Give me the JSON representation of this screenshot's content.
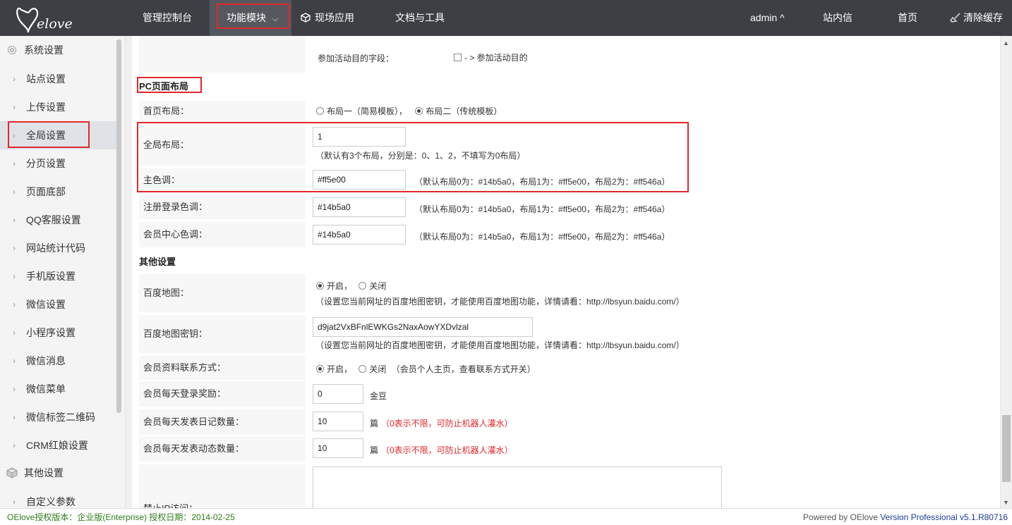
{
  "header": {
    "logo_text": "OElove",
    "nav": [
      "管理控制台",
      "功能模块",
      "现场应用",
      "文档与工具"
    ],
    "user": "admin ^",
    "right_links": [
      "站内信",
      "首页",
      "清除缓存"
    ]
  },
  "sidebar": {
    "group1": "系统设置",
    "items": [
      "站点设置",
      "上传设置",
      "全局设置",
      "分页设置",
      "页面底部",
      "QQ客服设置",
      "网站统计代码",
      "手机版设置",
      "微信设置",
      "小程序设置",
      "微信消息",
      "微信菜单",
      "微信标签二维码",
      "CRM红娘设置"
    ],
    "group2": "其他设置",
    "items2": [
      "自定义参数"
    ]
  },
  "form": {
    "activity_label": "参加活动目的字段：",
    "activity_option": "- > 参加活动目的",
    "pc_section": "PC页面布局",
    "home_layout_label": "首页布局：",
    "home_layout_opt1": "布局一（简易模板），",
    "home_layout_opt2": "布局二（传统模板）",
    "global_layout_label": "全局布局：",
    "global_layout_value": "1",
    "global_layout_note": "（默认有3个布局，分别是：0、1、2，不填写为0布局）",
    "main_color_label": "主色调：",
    "main_color_value": "#ff5e00",
    "color_note": "（默认布局0为：#14b5a0，布局1为：#ff5e00，布局2为：#ff546a）",
    "reg_color_label": "注册登录色调：",
    "reg_color_value": "#14b5a0",
    "member_color_label": "会员中心色调：",
    "member_color_value": "#14b5a0",
    "other_section": "其他设置",
    "baidu_map_label": "百度地图：",
    "on_label": "开启，",
    "off_label": "关闭",
    "baidu_map_note": "（设置您当前网址的百度地图密钥，才能使用百度地图功能，详情请看：http://lbsyun.baidu.com/）",
    "baidu_key_label": "百度地图密钥：",
    "baidu_key_value": "d9jat2VxBFnlEWKGs2NaxAowYXDvlzal",
    "contact_label": "会员资料联系方式：",
    "contact_note": "（会员个人主页，查看联系方式开关）",
    "daily_login_label": "会员每天登录奖励：",
    "daily_login_value": "0",
    "daily_login_unit": "金豆",
    "diary_label": "会员每天发表日记数量：",
    "diary_value": "10",
    "unit_pian": "篇",
    "unlimited_note": "（0表示不限，可防止机器人灌水）",
    "dynamic_label": "会员每天发表动态数量：",
    "dynamic_value": "10",
    "ban_ip_label": "禁止IP访问："
  },
  "footer": {
    "license": "OElove授权版本：企业版(Enterprise) 授权日期：2014-02-25",
    "powered": "Powered by OElove",
    "version": "Version Professional v5.1.R80716"
  },
  "colors": {
    "header_bg": "#3d3f44",
    "highlight_red": "#e3262b",
    "footer_green": "#2e7d1a",
    "version_blue": "#1c3c9a"
  }
}
